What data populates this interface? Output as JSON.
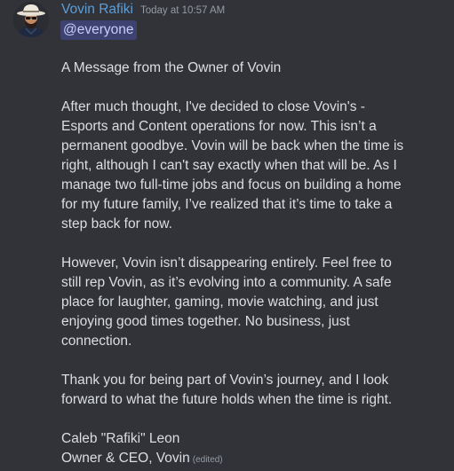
{
  "author": {
    "name": "Vovin Rafiki",
    "timestamp": "Today at 10:57 AM",
    "avatar": "avatar-cowboy-hat-icon"
  },
  "mention": "@everyone",
  "paragraphs": [
    [
      "A Message from the Owner of Vovin"
    ],
    [
      "After much thought, I've decided to close Vovin's -",
      "Esports and Content operations for now. This isn’t a",
      "permanent goodbye. Vovin will be back when the time is",
      "right, although I can't say exactly when that will be. As I",
      "manage two full-time jobs and focus on building a home",
      "for my future family, I’ve realized that it’s time to take a",
      "step back for now."
    ],
    [
      "However, Vovin isn’t disappearing entirely. Feel free to",
      "still rep Vovin, as it’s evolving into a community. A safe",
      "place for laughter, gaming, movie watching, and just",
      "enjoying good times together. No business, just",
      "connection."
    ],
    [
      "Thank you for being part of Vovin’s journey, and I look",
      "forward to what the future holds when the time is right."
    ],
    [
      "Caleb \"Rafiki\" Leon",
      "Owner & CEO, Vovin"
    ]
  ],
  "edited_label": "(edited)",
  "colors": {
    "background": "#323339",
    "username": "#5c9ed8",
    "text": "#dbdee1",
    "muted": "#949ba4",
    "mention_bg": "#3d4270",
    "mention_text": "#c9cdfb"
  }
}
